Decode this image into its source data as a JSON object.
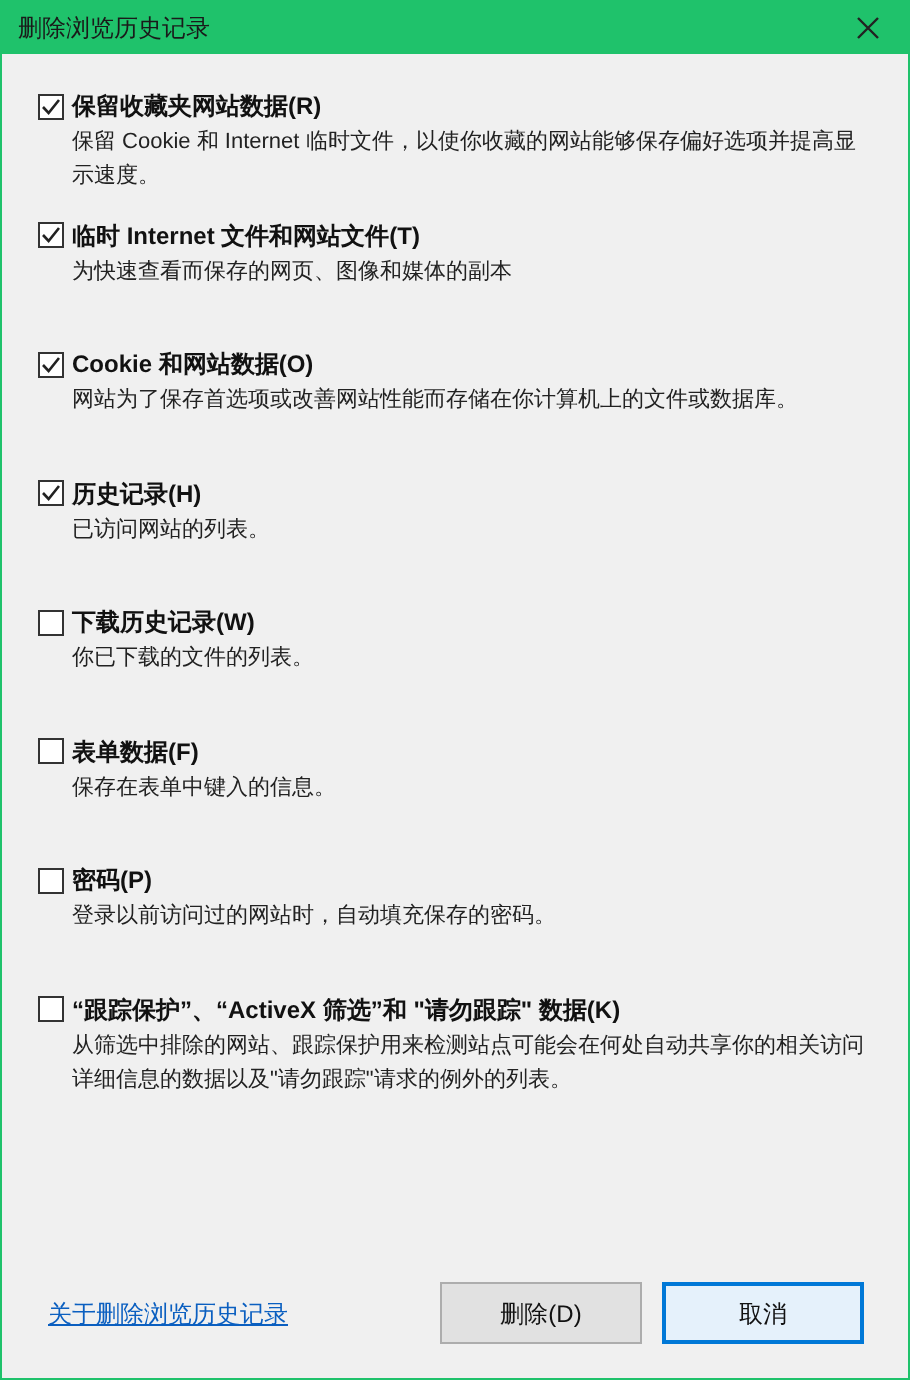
{
  "window": {
    "title": "删除浏览历史记录"
  },
  "options": [
    {
      "label": "保留收藏夹网站数据(R)",
      "description": "保留 Cookie 和 Internet 临时文件，以使你收藏的网站能够保存偏好选项并提高显示速度。",
      "checked": true
    },
    {
      "label": "临时 Internet 文件和网站文件(T)",
      "description": "为快速查看而保存的网页、图像和媒体的副本",
      "checked": true
    },
    {
      "label": "Cookie 和网站数据(O)",
      "description": "网站为了保存首选项或改善网站性能而存储在你计算机上的文件或数据库。",
      "checked": true
    },
    {
      "label": "历史记录(H)",
      "description": "已访问网站的列表。",
      "checked": true
    },
    {
      "label": "下载历史记录(W)",
      "description": "你已下载的文件的列表。",
      "checked": false
    },
    {
      "label": "表单数据(F)",
      "description": "保存在表单中键入的信息。",
      "checked": false
    },
    {
      "label": "密码(P)",
      "description": "登录以前访问过的网站时，自动填充保存的密码。",
      "checked": false
    },
    {
      "label": "“跟踪保护”、“ActiveX 筛选”和 \"请勿跟踪\" 数据(K)",
      "description": "从筛选中排除的网站、跟踪保护用来检测站点可能会在何处自动共享你的相关访问详细信息的数据以及\"请勿跟踪\"请求的例外的列表。",
      "checked": false
    }
  ],
  "help_link": "关于删除浏览历史记录",
  "buttons": [
    {
      "label": "删除(D)",
      "focused": false
    },
    {
      "label": "取消",
      "focused": true
    }
  ]
}
